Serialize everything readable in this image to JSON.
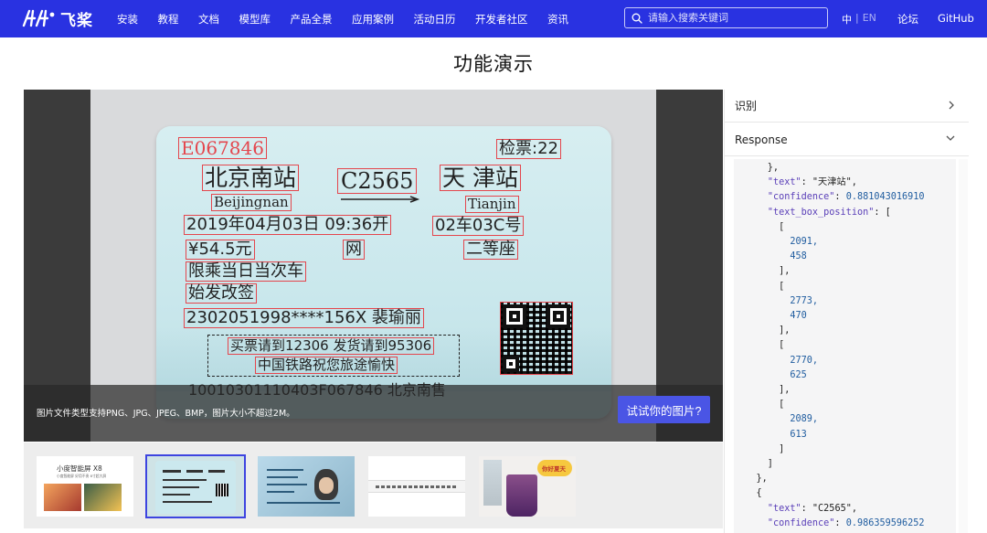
{
  "nav": {
    "logo_text": "飞桨",
    "items": [
      "安装",
      "教程",
      "文档",
      "模型库",
      "产品全景",
      "应用案例",
      "活动日历",
      "开发者社区",
      "资讯"
    ],
    "search_placeholder": "请输入搜索关键词",
    "lang_zh": "中",
    "lang_sep": "|",
    "lang_en": "EN",
    "forum": "论坛",
    "github": "GitHub",
    "bg_color": "#2932e1"
  },
  "page": {
    "title": "功能演示"
  },
  "demo": {
    "caption": "图片文件类型支持PNG、JPG、JPEG、BMP，图片大小不超过2M。",
    "try_button": "试试你的图片?",
    "ticket": {
      "ticket_no": "E067846",
      "gate": "检票:22",
      "from": "北京南站",
      "train": "C2565",
      "to": "天 津站",
      "from_py": "Beijingnan",
      "to_py": "Tianjin",
      "datetime": "2019年04月03日 09:36开",
      "seat": "02车03C号",
      "price": "¥54.5元",
      "channel": "网",
      "class": "二等座",
      "note1": "限乘当日当次车",
      "note2": "始发改签",
      "id": "2302051998****156X 裴瑜丽",
      "notice1": "买票请到12306 发货请到95306",
      "notice2": "中国铁路祝您旅途愉快",
      "serial": "10010301110403F067846 北京南售"
    }
  },
  "thumbs": {
    "t1_brand": "小度智能屏 X8",
    "t1_sub": "小度智能屏 好用不贵  8寸超大屏",
    "t5_badge": "你好夏天"
  },
  "panel": {
    "recognize_label": "识别",
    "response_label": "Response",
    "json_lines": [
      {
        "t": "p",
        "v": "      },"
      },
      {
        "t": "kv",
        "indent": "      ",
        "k": "\"text\"",
        "v": "\"天津站\"",
        "end": ","
      },
      {
        "t": "kv",
        "indent": "      ",
        "k": "\"confidence\"",
        "v": "0.881043016910",
        "end": "",
        "num": true
      },
      {
        "t": "kv",
        "indent": "      ",
        "k": "\"text_box_position\"",
        "v": "[",
        "end": ""
      },
      {
        "t": "p",
        "v": "        ["
      },
      {
        "t": "n",
        "v": "          2091,"
      },
      {
        "t": "n",
        "v": "          458"
      },
      {
        "t": "p",
        "v": "        ],"
      },
      {
        "t": "p",
        "v": "        ["
      },
      {
        "t": "n",
        "v": "          2773,"
      },
      {
        "t": "n",
        "v": "          470"
      },
      {
        "t": "p",
        "v": "        ],"
      },
      {
        "t": "p",
        "v": "        ["
      },
      {
        "t": "n",
        "v": "          2770,"
      },
      {
        "t": "n",
        "v": "          625"
      },
      {
        "t": "p",
        "v": "        ],"
      },
      {
        "t": "p",
        "v": "        ["
      },
      {
        "t": "n",
        "v": "          2089,"
      },
      {
        "t": "n",
        "v": "          613"
      },
      {
        "t": "p",
        "v": "        ]"
      },
      {
        "t": "p",
        "v": "      ]"
      },
      {
        "t": "p",
        "v": "    },"
      },
      {
        "t": "p",
        "v": "    {"
      },
      {
        "t": "kv",
        "indent": "      ",
        "k": "\"text\"",
        "v": "\"C2565\"",
        "end": ","
      },
      {
        "t": "kv",
        "indent": "      ",
        "k": "\"confidence\"",
        "v": "0.986359596252",
        "end": "",
        "num": true
      },
      {
        "t": "kv",
        "indent": "      ",
        "k": "\"text_box_position\"",
        "v": "[",
        "end": ""
      }
    ]
  }
}
